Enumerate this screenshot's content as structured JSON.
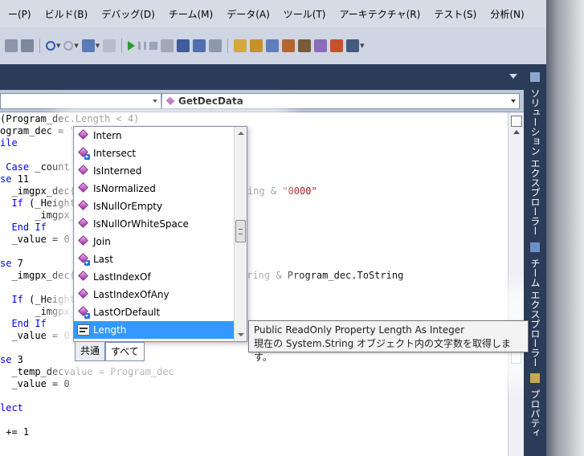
{
  "menu": [
    "ー(P)",
    "ビルド(B)",
    "デバッグ(D)",
    "チーム(M)",
    "データ(A)",
    "ツール(T)",
    "アーキテクチャ(R)",
    "テスト(S)",
    "分析(N)"
  ],
  "nav": {
    "left_combo": "",
    "right_combo": "GetDecData"
  },
  "code": {
    "l1": "(Program_dec.Length < 4)",
    "l2_a": "ogram_dec = ",
    "l2_b": "\"",
    "l3": "ile",
    "l5_a": " Case",
    "l5_b": " _count",
    "l6_a": "se",
    "l6_b": " 11",
    "l7": "  _imgpx_dec(",
    "l7_r_a": "ing & ",
    "l7_r_b": "\"0000\"",
    "l8_a": "  If",
    "l8_b": " (_Height",
    "l9": "      _imgpx_",
    "l10_a": "  End If",
    "l11": "  _value = 0",
    "l13_a": "se",
    "l13_b": " 7",
    "l14": "  _imgpx_dec(",
    "l14_r": "tring & Program_dec.ToString",
    "l16_a": "  If",
    "l16_b": " (_Height",
    "l17": "      _imgpx_",
    "l18": "  End If",
    "l19": "  _value = 0",
    "l21_a": "se",
    "l21_b": " 3",
    "l22": "  _temp_decvalue = Program_dec",
    "l23": "  _value = 0",
    "l25": "lect",
    "l27": " += 1"
  },
  "intellisense": {
    "items": [
      {
        "label": "Intern",
        "ext": false
      },
      {
        "label": "Intersect",
        "ext": true
      },
      {
        "label": "IsInterned",
        "ext": false
      },
      {
        "label": "IsNormalized",
        "ext": false
      },
      {
        "label": "IsNullOrEmpty",
        "ext": false
      },
      {
        "label": "IsNullOrWhiteSpace",
        "ext": false
      },
      {
        "label": "Join",
        "ext": false
      },
      {
        "label": "Last",
        "ext": true
      },
      {
        "label": "LastIndexOf",
        "ext": false
      },
      {
        "label": "LastIndexOfAny",
        "ext": false
      },
      {
        "label": "LastOrDefault",
        "ext": true
      }
    ],
    "selected": "Length",
    "tabs": {
      "common": "共通",
      "all": "すべて"
    }
  },
  "tooltip": {
    "line1": "Public ReadOnly Property Length As Integer",
    "line2": "現在の System.String オブジェクト内の文字数を取得します。"
  },
  "side_tabs": {
    "solution_explorer": "ソリューション エクスプローラー",
    "team_explorer": "チーム エクスプローラー",
    "properties": "プロパティ"
  },
  "colors": {
    "accent": "#3399ff",
    "dock": "#2b3c59",
    "keyword": "#0000ff",
    "string": "#a31515"
  }
}
